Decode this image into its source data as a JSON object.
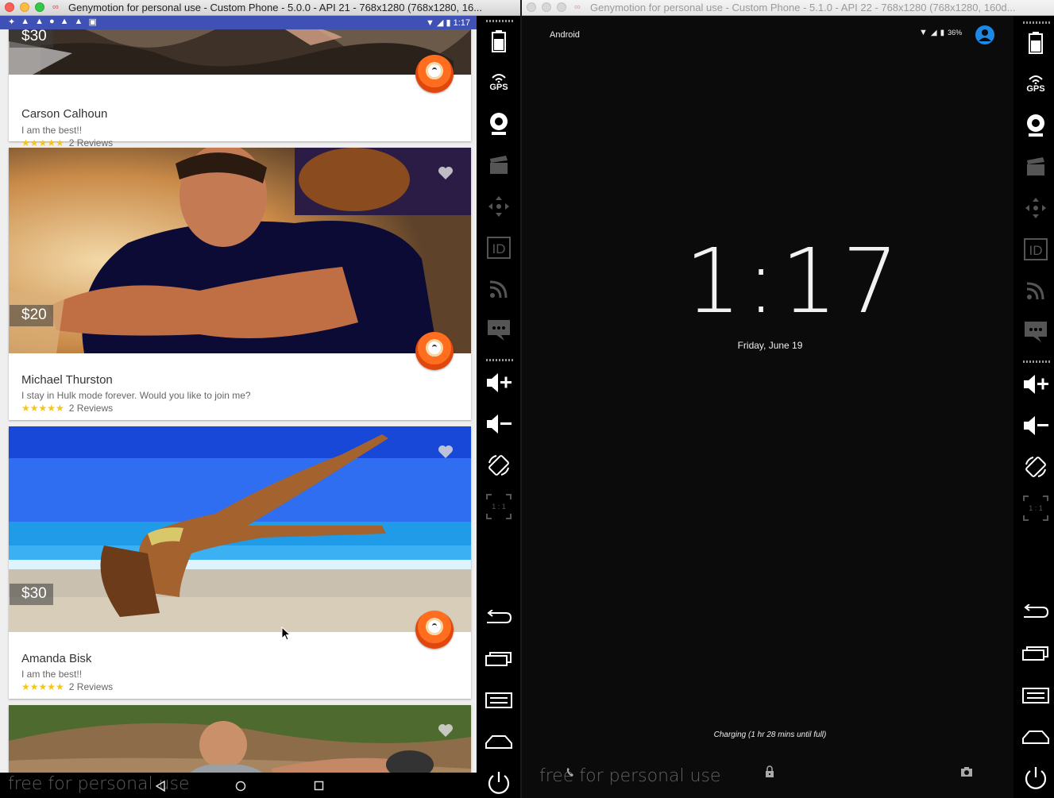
{
  "window1": {
    "title": "Genymotion for personal use - Custom Phone - 5.0.0 - API 21 - 768x1280 (768x1280, 16...",
    "status_time": "1:17",
    "cards": [
      {
        "price": "$30",
        "name": "Carson Calhoun",
        "description": "I am the best!!",
        "stars": "★★★★★",
        "reviews": "2 Reviews"
      },
      {
        "price": "$20",
        "name": "Michael Thurston",
        "description": "I stay in Hulk mode forever. Would you like to  join me?",
        "stars": "★★★★★",
        "reviews": "2 Reviews"
      },
      {
        "price": "$30",
        "name": "Amanda Bisk",
        "description": "I am the best!!",
        "stars": "★★★★★",
        "reviews": "2 Reviews"
      }
    ],
    "watermark": "free for personal use"
  },
  "window2": {
    "title": "Genymotion for personal use - Custom Phone - 5.1.0 - API 22 - 768x1280 (768x1280, 160d...",
    "carrier": "Android",
    "battery": "36%",
    "clock": "1:17",
    "date": "Friday, June 19",
    "charging": "Charging (1 hr 28 mins until full)",
    "watermark": "free for personal use"
  },
  "toolbar": {
    "items": [
      "battery-icon",
      "gps-icon",
      "webcam-icon",
      "capture-icon",
      "dpad-icon",
      "device-id-icon",
      "network-icon",
      "sms-icon",
      "volume-up-icon",
      "volume-down-icon",
      "rotate-icon",
      "pixel-perfect-icon",
      "back-icon",
      "recent-apps-icon",
      "menu-icon",
      "home-icon",
      "power-icon"
    ],
    "gps_label": "GPS",
    "id_label": "ID",
    "scale_label": "1 : 1"
  },
  "colors": {
    "statusbar": "#3f51b5",
    "star": "#f5c518",
    "avatar": "#ff6d1f",
    "lock_user": "#1e88e5"
  }
}
